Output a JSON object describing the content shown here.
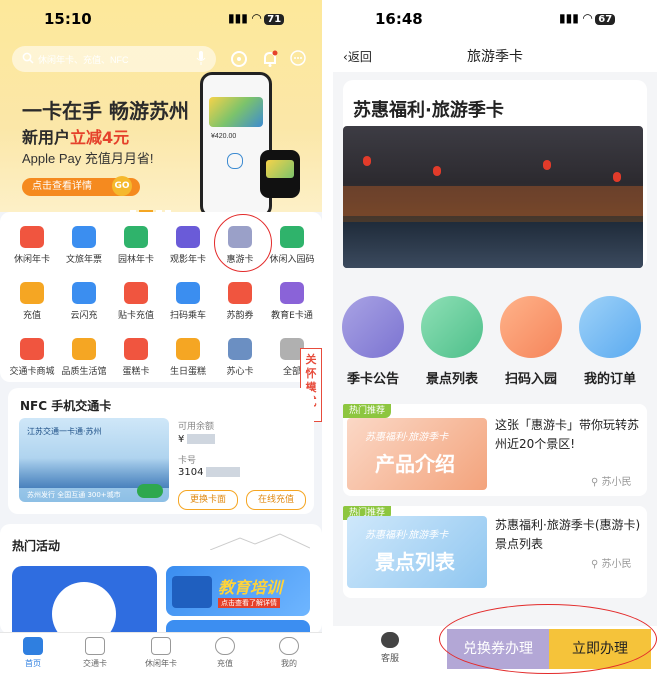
{
  "left": {
    "status": {
      "time": "15:10",
      "battery": "71"
    },
    "search": {
      "placeholder": "休闲年卡、充值、NFC"
    },
    "banner": {
      "title": "一卡在手 畅游苏州",
      "subtitle_prefix": "新用户",
      "subtitle_highlight": "立减4元",
      "apple_pay": "Apple Pay 充值月月省!",
      "cta": "点击查看详情",
      "cta_go": "GO",
      "phone_amount": "¥420.00"
    },
    "grid": [
      [
        "休闲年卡",
        "文旅年票",
        "园林年卡",
        "观影年卡",
        "惠游卡",
        "休闲入园码"
      ],
      [
        "充值",
        "云闪充",
        "贴卡充值",
        "扫码乘车",
        "苏韵券",
        "教育E卡通"
      ],
      [
        "交通卡商城",
        "品质生活馆",
        "蛋糕卡",
        "生日蛋糕",
        "苏心卡",
        "全部"
      ]
    ],
    "care_mode": "关怀模式",
    "nfc": {
      "title": "NFC 手机交通卡",
      "card_title": "江苏交通一卡通·苏州",
      "card_footer": "苏州发行 全国互通 300+城市",
      "balance_label": "可用余额",
      "balance_value": "¥",
      "card_no_label": "卡号",
      "card_no_value": "3104",
      "change_button": "更换卡面",
      "recharge_button": "在线充值"
    },
    "activity": {
      "title": "热门活动",
      "edu_title": "教育培训",
      "edu_sub": "点击查看了解详情"
    },
    "nav": [
      "首页",
      "交通卡",
      "休闲年卡",
      "充值",
      "我的"
    ]
  },
  "right": {
    "status": {
      "time": "16:48",
      "battery": "67"
    },
    "back": "返回",
    "title": "旅游季卡",
    "card_title": "苏惠福利·旅游季卡",
    "menu": [
      "季卡公告",
      "景点列表",
      "扫码入园",
      "我的订单"
    ],
    "hot_tag": "热门推荐",
    "items": [
      {
        "thumb_brand": "苏惠福利·旅游季卡",
        "thumb_label": "产品介绍",
        "text": "这张「惠游卡」带你玩转苏州近20个景区!",
        "author": "苏小民"
      },
      {
        "thumb_brand": "苏惠福利·旅游季卡",
        "thumb_label": "景点列表",
        "text": "苏惠福利·旅游季卡(惠游卡)景点列表",
        "author": "苏小民"
      }
    ],
    "service": "客服",
    "exchange_button": "兑换券办理",
    "apply_button": "立即办理"
  },
  "colors": {
    "accent_orange": "#f58a1f",
    "highlight_red": "#e5412b",
    "apply_yellow": "#f5c33a",
    "exchange_purple": "#b3a7d6",
    "annotation_red": "#e32b2b"
  }
}
